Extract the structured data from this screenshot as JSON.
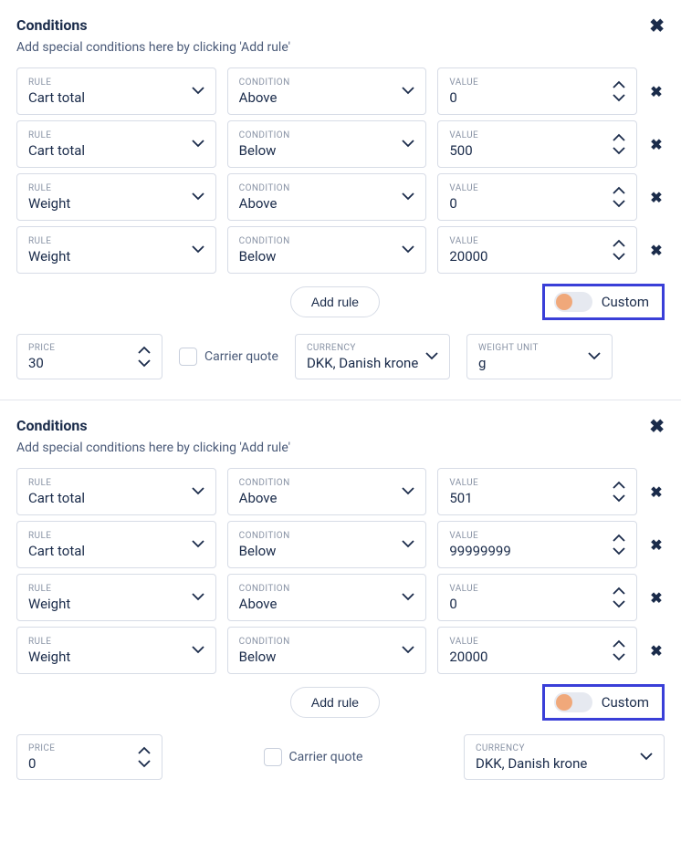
{
  "sections": [
    {
      "title": "Conditions",
      "subtitle": "Add special conditions here by clicking 'Add rule'",
      "rules": [
        {
          "rule_label": "RULE",
          "rule": "Cart total",
          "cond_label": "CONDITION",
          "cond": "Above",
          "val_label": "VALUE",
          "val": "0"
        },
        {
          "rule_label": "RULE",
          "rule": "Cart total",
          "cond_label": "CONDITION",
          "cond": "Below",
          "val_label": "VALUE",
          "val": "500"
        },
        {
          "rule_label": "RULE",
          "rule": "Weight",
          "cond_label": "CONDITION",
          "cond": "Above",
          "val_label": "VALUE",
          "val": "0"
        },
        {
          "rule_label": "RULE",
          "rule": "Weight",
          "cond_label": "CONDITION",
          "cond": "Below",
          "val_label": "VALUE",
          "val": "20000"
        }
      ],
      "add_rule_label": "Add rule",
      "custom_label": "Custom",
      "bottom": {
        "price_label": "PRICE",
        "price": "30",
        "carrier_quote_label": "Carrier quote",
        "currency_label": "CURRENCY",
        "currency": "DKK, Danish krone",
        "weight_unit_label": "WEIGHT UNIT",
        "weight_unit": "g",
        "show_weight": true
      }
    },
    {
      "title": "Conditions",
      "subtitle": "Add special conditions here by clicking 'Add rule'",
      "rules": [
        {
          "rule_label": "RULE",
          "rule": "Cart total",
          "cond_label": "CONDITION",
          "cond": "Above",
          "val_label": "VALUE",
          "val": "501"
        },
        {
          "rule_label": "RULE",
          "rule": "Cart total",
          "cond_label": "CONDITION",
          "cond": "Below",
          "val_label": "VALUE",
          "val": "99999999"
        },
        {
          "rule_label": "RULE",
          "rule": "Weight",
          "cond_label": "CONDITION",
          "cond": "Above",
          "val_label": "VALUE",
          "val": "0"
        },
        {
          "rule_label": "RULE",
          "rule": "Weight",
          "cond_label": "CONDITION",
          "cond": "Below",
          "val_label": "VALUE",
          "val": "20000"
        }
      ],
      "add_rule_label": "Add rule",
      "custom_label": "Custom",
      "bottom": {
        "price_label": "PRICE",
        "price": "0",
        "carrier_quote_label": "Carrier quote",
        "currency_label": "CURRENCY",
        "currency": "DKK, Danish krone",
        "show_weight": false
      }
    }
  ]
}
